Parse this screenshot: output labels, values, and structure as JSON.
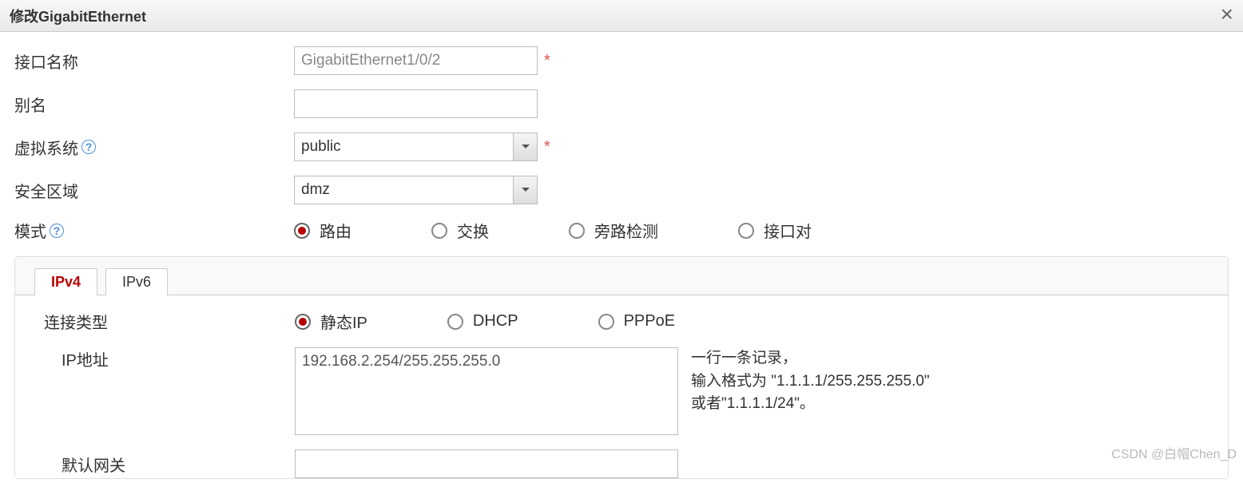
{
  "dialog": {
    "title": "修改GigabitEthernet"
  },
  "labels": {
    "ifname": "接口名称",
    "alias": "别名",
    "vsys": "虚拟系统",
    "zone": "安全区域",
    "mode": "模式",
    "conn": "连接类型",
    "ip": "IP地址",
    "gw": "默认网关"
  },
  "fields": {
    "ifname": "GigabitEthernet1/0/2",
    "alias": "",
    "vsys": "public",
    "zone": "dmz",
    "ip": "192.168.2.254/255.255.255.0"
  },
  "mode_options": {
    "route": "路由",
    "switch": "交换",
    "bypass": "旁路检测",
    "pair": "接口对"
  },
  "tabs": {
    "ipv4": "IPv4",
    "ipv6": "IPv6"
  },
  "conn_options": {
    "static": "静态IP",
    "dhcp": "DHCP",
    "pppoe": "PPPoE"
  },
  "hint": {
    "l1": "一行一条记录，",
    "l2": "输入格式为 \"1.1.1.1/255.255.255.0\"",
    "l3": "或者\"1.1.1.1/24\"。"
  },
  "watermark": "CSDN @白帽Chen_D"
}
